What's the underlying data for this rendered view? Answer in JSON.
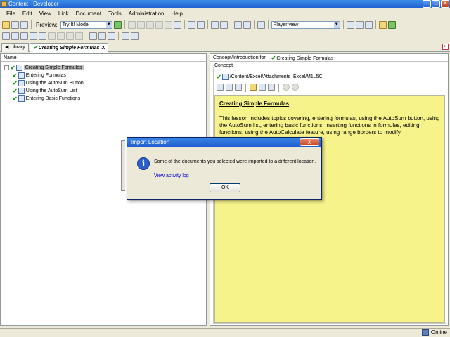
{
  "window": {
    "title": "Content - Developer",
    "minimize": "_",
    "maximize": "□",
    "close": "X"
  },
  "menu": [
    "File",
    "Edit",
    "View",
    "Link",
    "Document",
    "Tools",
    "Administration",
    "Help"
  ],
  "toolbar": {
    "preview_label": "Preview:",
    "preview_mode": "Try It! Mode",
    "view_mode": "Player view"
  },
  "tabs": [
    {
      "label": "Library"
    },
    {
      "label": "Creating Simple Formulas",
      "close": "X"
    }
  ],
  "left_pane": {
    "header": "Name",
    "tree": [
      {
        "label": "Creating Simple Formulas",
        "level": 0,
        "selected": true,
        "toggle": "-"
      },
      {
        "label": "Entering Formulas",
        "level": 1
      },
      {
        "label": "Using the AutoSum Button",
        "level": 1
      },
      {
        "label": "Using the AutoSum List",
        "level": 1
      },
      {
        "label": "Entering Basic Functions",
        "level": 1
      }
    ]
  },
  "right_pane": {
    "concept_for_label": "Concept/Introduction for:",
    "concept_for_title": "Creating Simple Formulas",
    "group_label": "Concept",
    "path": "/Content/Excel/Attachments_Excel/M1L5C",
    "content_title": "Creating Simple Formulas",
    "content_body": "This lesson includes topics covering, entering formulas, using the AutoSum button, using the AutoSum list, entering basic functions, inserting functions in formulas, editing functions, using the AutoCalculate feature, using range borders to modify"
  },
  "dialog": {
    "title": "Import Location",
    "close": "X",
    "message": "Some of the documents you selected were imported to a different location.",
    "link": "View activity log",
    "ok": "OK"
  },
  "status": {
    "text": "Online"
  },
  "colors": {
    "content_background": "#f6f38a",
    "titlebar": "#1f5fd0",
    "check": "#1a9a1a"
  }
}
